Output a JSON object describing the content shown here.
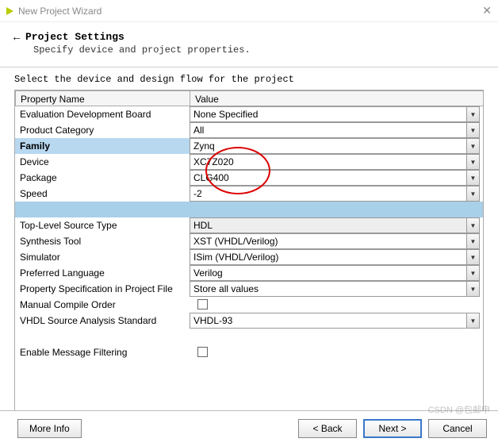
{
  "window": {
    "title": "New Project Wizard"
  },
  "header": {
    "title": "Project Settings",
    "subtitle": "Specify device and project properties."
  },
  "section_label": "Select the device and design flow for the project",
  "table": {
    "col_property": "Property Name",
    "col_value": "Value",
    "rows": [
      {
        "label": "Evaluation Development Board",
        "value": "None Specified",
        "type": "select"
      },
      {
        "label": "Product Category",
        "value": "All",
        "type": "select"
      },
      {
        "label": "Family",
        "value": "Zynq",
        "type": "select",
        "highlight": true
      },
      {
        "label": "Device",
        "value": "XC7Z020",
        "type": "select"
      },
      {
        "label": "Package",
        "value": "CLG400",
        "type": "select"
      },
      {
        "label": "Speed",
        "value": "-2",
        "type": "select"
      },
      {
        "label": "",
        "value": "",
        "type": "bluebar"
      },
      {
        "label": "Top-Level Source Type",
        "value": "HDL",
        "type": "select-disabled"
      },
      {
        "label": "Synthesis Tool",
        "value": "XST (VHDL/Verilog)",
        "type": "select"
      },
      {
        "label": "Simulator",
        "value": "ISim (VHDL/Verilog)",
        "type": "select"
      },
      {
        "label": "Preferred Language",
        "value": "Verilog",
        "type": "select"
      },
      {
        "label": "Property Specification in Project File",
        "value": "Store all values",
        "type": "select"
      },
      {
        "label": "Manual Compile Order",
        "value": "",
        "type": "checkbox"
      },
      {
        "label": "VHDL Source Analysis Standard",
        "value": "VHDL-93",
        "type": "select"
      },
      {
        "label": "",
        "value": "",
        "type": "blank"
      },
      {
        "label": "Enable Message Filtering",
        "value": "",
        "type": "checkbox"
      }
    ]
  },
  "footer": {
    "more_info": "More Info",
    "back": "< Back",
    "next": "Next >",
    "cancel": "Cancel"
  },
  "watermark": "CSDN @包邮申"
}
